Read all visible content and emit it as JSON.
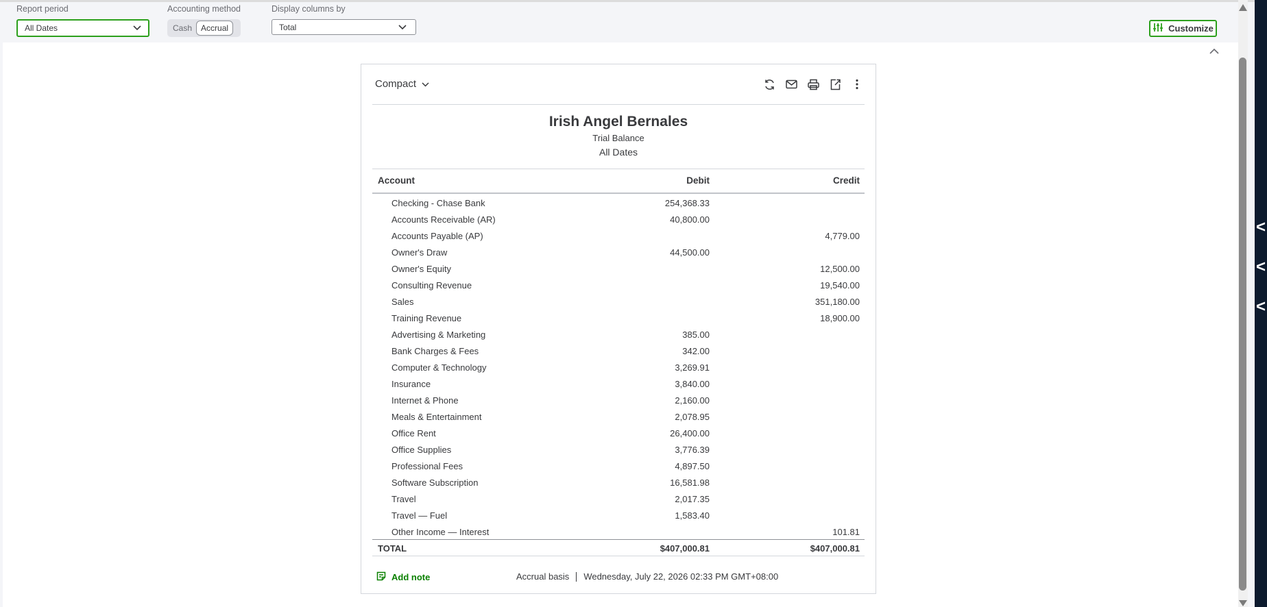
{
  "filters": {
    "report_period_label": "Report period",
    "report_period_value": "All Dates",
    "accounting_method_label": "Accounting method",
    "method_options": [
      "Cash",
      "Accrual"
    ],
    "method_selected": "Accrual",
    "display_columns_label": "Display columns by",
    "display_columns_value": "Total",
    "customize_label": "Customize"
  },
  "toolbar": {
    "view_label": "Compact",
    "icons": [
      "refresh-icon",
      "email-icon",
      "print-icon",
      "export-icon",
      "more-options-icon"
    ]
  },
  "report": {
    "company": "Irish Angel Bernales",
    "title": "Trial Balance",
    "dates": "All Dates",
    "columns": {
      "account": "Account",
      "debit": "Debit",
      "credit": "Credit"
    },
    "rows": [
      {
        "account": "Checking - Chase Bank",
        "debit": "254,368.33",
        "credit": ""
      },
      {
        "account": "Accounts Receivable (AR)",
        "debit": "40,800.00",
        "credit": ""
      },
      {
        "account": "Accounts Payable (AP)",
        "debit": "",
        "credit": "4,779.00"
      },
      {
        "account": "Owner's Draw",
        "debit": "44,500.00",
        "credit": ""
      },
      {
        "account": "Owner's Equity",
        "debit": "",
        "credit": "12,500.00"
      },
      {
        "account": "Consulting Revenue",
        "debit": "",
        "credit": "19,540.00"
      },
      {
        "account": "Sales",
        "debit": "",
        "credit": "351,180.00"
      },
      {
        "account": "Training Revenue",
        "debit": "",
        "credit": "18,900.00"
      },
      {
        "account": "Advertising & Marketing",
        "debit": "385.00",
        "credit": ""
      },
      {
        "account": "Bank Charges & Fees",
        "debit": "342.00",
        "credit": ""
      },
      {
        "account": "Computer & Technology",
        "debit": "3,269.91",
        "credit": ""
      },
      {
        "account": "Insurance",
        "debit": "3,840.00",
        "credit": ""
      },
      {
        "account": "Internet & Phone",
        "debit": "2,160.00",
        "credit": ""
      },
      {
        "account": "Meals & Entertainment",
        "debit": "2,078.95",
        "credit": ""
      },
      {
        "account": "Office Rent",
        "debit": "26,400.00",
        "credit": ""
      },
      {
        "account": "Office Supplies",
        "debit": "3,776.39",
        "credit": ""
      },
      {
        "account": "Professional Fees",
        "debit": "4,897.50",
        "credit": ""
      },
      {
        "account": "Software Subscription",
        "debit": "16,581.98",
        "credit": ""
      },
      {
        "account": "Travel",
        "debit": "2,017.35",
        "credit": ""
      },
      {
        "account": "Travel — Fuel",
        "debit": "1,583.40",
        "credit": ""
      },
      {
        "account": "Other Income — Interest",
        "debit": "",
        "credit": "101.81"
      }
    ],
    "total": {
      "label": "TOTAL",
      "debit": "$407,000.81",
      "credit": "$407,000.81"
    }
  },
  "footer": {
    "add_note": "Add note",
    "basis": "Accrual basis",
    "timestamp": "Wednesday, July 22, 2026 02:33 PM GMT+08:00"
  },
  "colors": {
    "brand_green": "#2ca01c",
    "link_green": "#0a8000",
    "sidebar": "#0d1b2e"
  }
}
